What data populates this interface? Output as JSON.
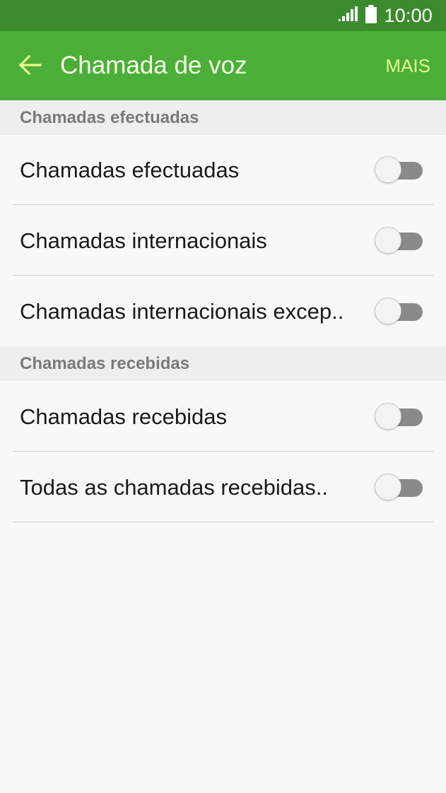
{
  "status_bar": {
    "time": "10:00",
    "signal_icon": "signal-icon",
    "battery_icon": "battery-icon"
  },
  "app_bar": {
    "title": "Chamada de voz",
    "more_label": "MAIS",
    "back_icon": "back-arrow-icon"
  },
  "sections": [
    {
      "header": "Chamadas efectuadas",
      "items": [
        {
          "label": "Chamadas efectuadas",
          "enabled": false
        },
        {
          "label": "Chamadas internacionais",
          "enabled": false
        },
        {
          "label": "Chamadas internacionais excep..",
          "enabled": false
        }
      ]
    },
    {
      "header": "Chamadas recebidas",
      "items": [
        {
          "label": "Chamadas recebidas",
          "enabled": false
        },
        {
          "label": "Todas as chamadas recebidas..",
          "enabled": false
        }
      ]
    }
  ],
  "colors": {
    "status_bar": "#3c8a2e",
    "app_bar": "#4caf3a",
    "accent": "#e2ff8a"
  }
}
